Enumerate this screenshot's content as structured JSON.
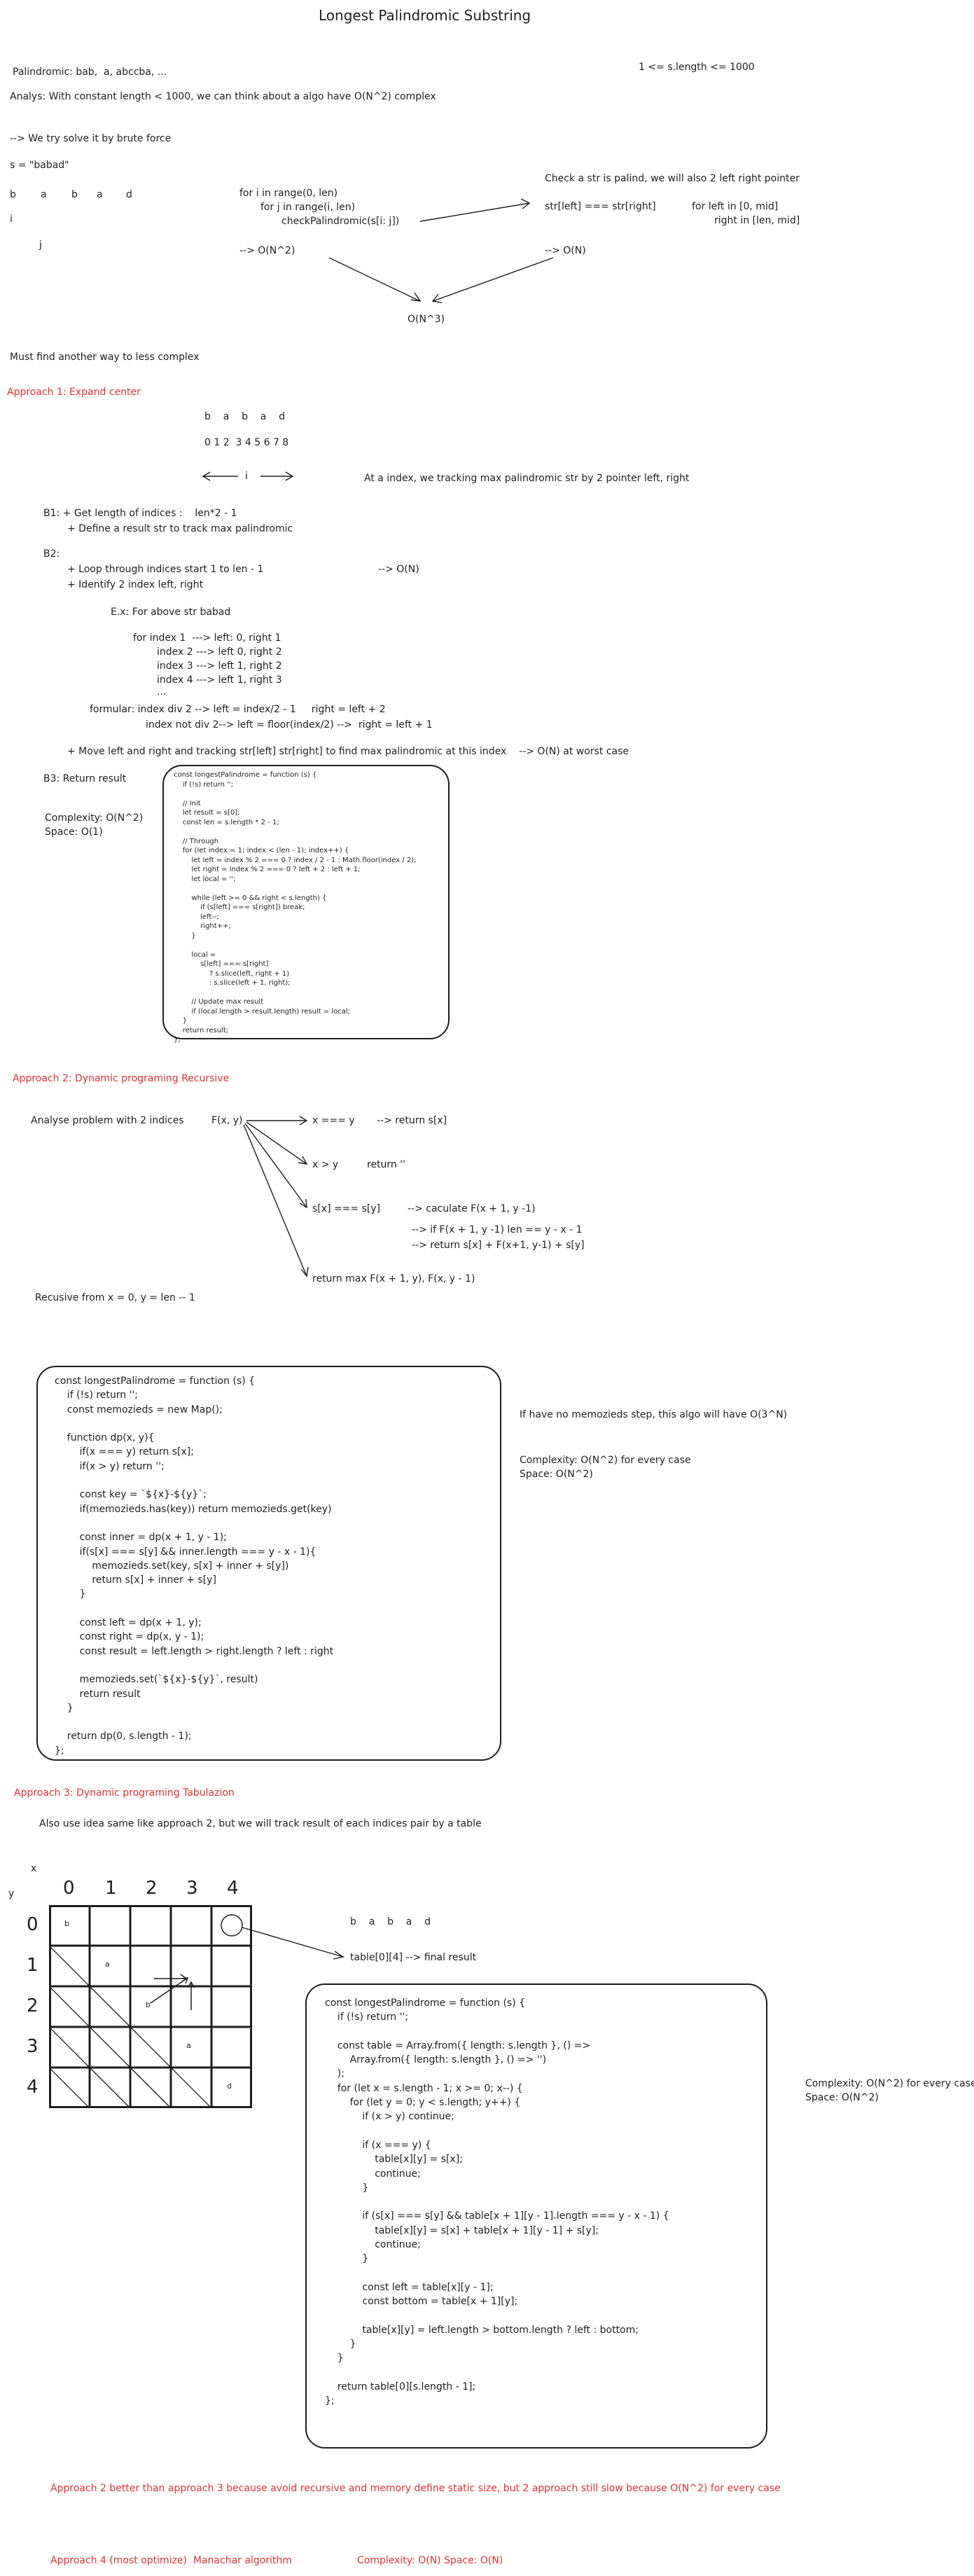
{
  "title": "Longest Palindromic Substring",
  "constraint": "1 <= s.length <= 1000",
  "intro": {
    "palindrome": "Palindromic: bab,  a, abccba, ...",
    "analys": "Analys: With constant length < 1000, we can think about a algo have O(N^2) complex",
    "brute": "--> We try solve it by brute force",
    "s_def": "s = \"babad\"",
    "letters": [
      "b",
      "a",
      "b",
      "a",
      "d"
    ],
    "i_label": "i",
    "j_label": "j",
    "loop1": "for i in range(0, len)",
    "loop2": "for j in range(i, len)",
    "loop3": "checkPalindromic(s[i: j])",
    "on2": "--> O(N^2)",
    "check": "Check a str is palind, we will also 2 left right pointer",
    "cmp": "str[left] === str[right]",
    "for_left": "for left in [0, mid]",
    "right_in": "right in [len, mid]",
    "on": "--> O(N)",
    "on3": "O(N^3)",
    "must": "Must find another way to less complex"
  },
  "approach1": {
    "heading": "Approach 1: Expand center",
    "letters": "b    a    b    a    d",
    "indices": "0 1 2  3 4 5 6 7 8",
    "arrow_i": "i",
    "at_index": "At a index, we tracking max palindromic str by 2 pointer left, right",
    "b1": "B1: + Get length of indices :    len*2 - 1",
    "b1b": "+ Define a result str to track max palindromic",
    "b2": "B2:",
    "b2a": "+ Loop through indices start 1 to len - 1",
    "b2a_c": "--> O(N)",
    "b2b": "+ Identify 2 index left, right",
    "ex": "E.x: For above str babad",
    "idx1": "for index 1  ---> left: 0, right 1",
    "idx2": "index 2 ---> left 0, right 2",
    "idx3": "index 3 ---> left 1, right 2",
    "idx4": "index 4 ---> left 1, right 3",
    "dots": "...",
    "formular1": "formular: index div 2 --> left = index/2 - 1     right = left + 2",
    "formular2": "index not div 2--> left = floor(index/2) -->  right = left + 1",
    "move": "+ Move left and right and tracking str[left] str[right] to find max palindromic at this index    --> O(N) at worst case",
    "b3": "B3: Return result",
    "complexity": "Complexity: O(N^2)",
    "space": "Space: O(1)",
    "code": "const longestPalindrome = function (s) {\n    if (!s) return '';\n\n    // Init\n    let result = s[0];\n    const len = s.length * 2 - 1;\n\n    // Through\n    for (let index = 1; index < (len - 1); index++) {\n        let left = index % 2 === 0 ? index / 2 - 1 : Math.floor(index / 2);\n        let right = index % 2 === 0 ? left + 2 : left + 1;\n        let local = '';\n\n        while (left >= 0 && right < s.length) {\n            if (s[left] === s[right]) break;\n            left--;\n            right++;\n        }\n\n        local =\n            s[left] === s[right]\n                ? s.slice(left, right + 1)\n                : s.slice(left + 1, right);\n\n        // Update max result\n        if (local.length > result.length) result = local;\n    }\n    return result;\n};"
  },
  "approach2": {
    "heading": "Approach 2: Dynamic programing Recursive",
    "analyse": "Analyse problem with 2 indices",
    "fxy": "F(x, y)",
    "case1": "x === y",
    "case1_r": "--> return s[x]",
    "case2": "x > y",
    "case2_r": "return ''",
    "case3": "s[x] === s[y]",
    "case3_r": "--> caculate F(x + 1, y -1)",
    "case3_a": "--> if F(x + 1, y -1) len == y - x - 1",
    "case3_b": "--> return s[x] + F(x+1, y-1) + s[y]",
    "case4": "return max F(x + 1, y), F(x, y - 1)",
    "recusive": "Recusive from x = 0, y = len -- 1",
    "note1": "If have no memozieds step, this algo will have O(3^N)",
    "complexity": "Complexity: O(N^2) for every case",
    "space": "Space: O(N^2)",
    "code": "const longestPalindrome = function (s) {\n    if (!s) return '';\n    const memozieds = new Map();\n\n    function dp(x, y){\n        if(x === y) return s[x];\n        if(x > y) return '';\n\n        const key = `${x}-${y}`;\n        if(memozieds.has(key)) return memozieds.get(key)\n\n        const inner = dp(x + 1, y - 1);\n        if(s[x] === s[y] && inner.length === y - x - 1){\n            memozieds.set(key, s[x] + inner + s[y])\n            return s[x] + inner + s[y]\n        }\n\n        const left = dp(x + 1, y);\n        const right = dp(x, y - 1);\n        const result = left.length > right.length ? left : right\n\n        memozieds.set(`${x}-${y}`, result)\n        return result\n    }\n\n    return dp(0, s.length - 1);\n};"
  },
  "approach3": {
    "heading": "Approach 3: Dynamic programing Tabulazion",
    "desc": "Also use idea same like approach 2, but we will track result of each indices pair by a table",
    "x_axis": "x",
    "y_axis": "y",
    "col_labels": [
      "0",
      "1",
      "2",
      "3",
      "4"
    ],
    "row_labels": [
      "0",
      "1",
      "2",
      "3",
      "4"
    ],
    "diag": [
      "b",
      "a",
      "b",
      "a",
      "d"
    ],
    "letters": "b    a    b    a    d",
    "final": "table[0][4] --> final result",
    "complexity": "Complexity: O(N^2) for every case",
    "space": "Space: O(N^2)",
    "code": "const longestPalindrome = function (s) {\n    if (!s) return '';\n\n    const table = Array.from({ length: s.length }, () =>\n        Array.from({ length: s.length }, () => '')\n    );\n    for (let x = s.length - 1; x >= 0; x--) {\n        for (let y = 0; y < s.length; y++) {\n            if (x > y) continue;\n\n            if (x === y) {\n                table[x][y] = s[x];\n                continue;\n            }\n\n            if (s[x] === s[y] && table[x + 1][y - 1].length === y - x - 1) {\n                table[x][y] = s[x] + table[x + 1][y - 1] + s[y];\n                continue;\n            }\n\n            const left = table[x][y - 1];\n            const bottom = table[x + 1][y];\n\n            table[x][y] = left.length > bottom.length ? left : bottom;\n        }\n    }\n\n    return table[0][s.length - 1];\n};"
  },
  "conclusion": "Approach 2 better than approach 3 because avoid recursive and memory define static size, but 2 approach still slow because O(N^2) for every case",
  "approach4": {
    "heading": "Approach 4 (most optimize)  Manachar algorithm",
    "complexity": "Complexity: O(N) Space: O(N)"
  },
  "colors": {
    "ink": "#1e1e1e",
    "accent": "#e03131"
  }
}
